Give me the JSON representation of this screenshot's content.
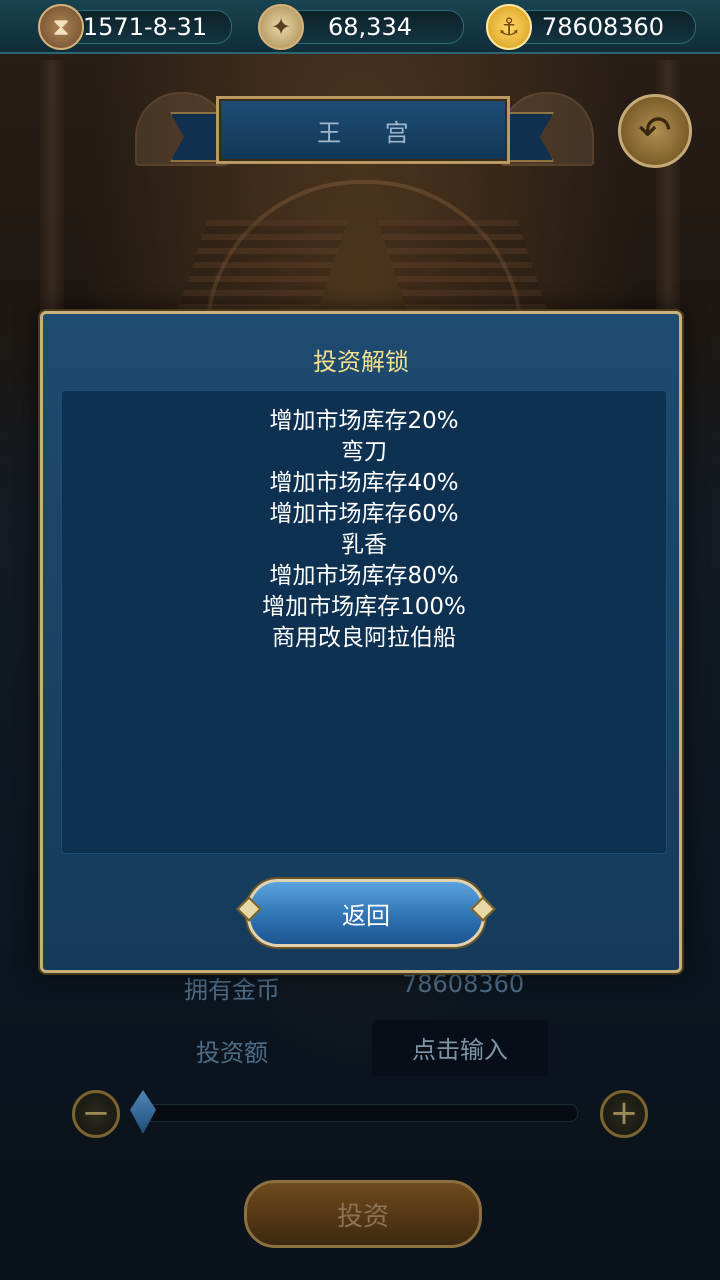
{
  "topbar": {
    "date": "1571-8-31",
    "reputation": "68,334",
    "gold": "78608360",
    "icons": [
      "hourglass-icon",
      "compass-icon",
      "gold-coin-icon"
    ]
  },
  "header": {
    "title": "王 宫"
  },
  "form": {
    "owned_gold_label": "拥有金币",
    "owned_gold_value": "78608360",
    "invest_amount_label": "投资额",
    "invest_input_placeholder": "点击输入",
    "invest_button": "投资",
    "minus_symbol": "−",
    "plus_symbol": "+"
  },
  "dialog": {
    "title": "投资解锁",
    "items": [
      "增加市场库存20%",
      "弯刀",
      "增加市场库存40%",
      "增加市场库存60%",
      "乳香",
      "增加市场库存80%",
      "增加市场库存100%",
      "商用改良阿拉伯船"
    ],
    "return_button": "返回"
  },
  "colors": {
    "dialog_bg": "#1e4b70",
    "dialog_border": "#c9b07a",
    "title_text": "#f1e08e",
    "button_blue": "#2f74b4"
  }
}
